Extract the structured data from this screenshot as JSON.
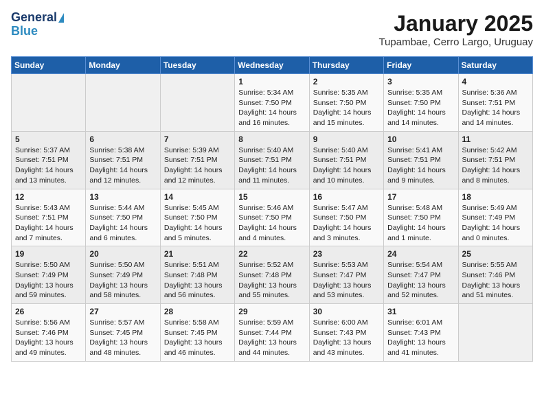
{
  "header": {
    "logo_general": "General",
    "logo_blue": "Blue",
    "title": "January 2025",
    "subtitle": "Tupambae, Cerro Largo, Uruguay"
  },
  "calendar": {
    "weekdays": [
      "Sunday",
      "Monday",
      "Tuesday",
      "Wednesday",
      "Thursday",
      "Friday",
      "Saturday"
    ],
    "weeks": [
      [
        {
          "day": "",
          "sunrise": "",
          "sunset": "",
          "daylight": ""
        },
        {
          "day": "",
          "sunrise": "",
          "sunset": "",
          "daylight": ""
        },
        {
          "day": "",
          "sunrise": "",
          "sunset": "",
          "daylight": ""
        },
        {
          "day": "1",
          "sunrise": "Sunrise: 5:34 AM",
          "sunset": "Sunset: 7:50 PM",
          "daylight": "Daylight: 14 hours and 16 minutes."
        },
        {
          "day": "2",
          "sunrise": "Sunrise: 5:35 AM",
          "sunset": "Sunset: 7:50 PM",
          "daylight": "Daylight: 14 hours and 15 minutes."
        },
        {
          "day": "3",
          "sunrise": "Sunrise: 5:35 AM",
          "sunset": "Sunset: 7:50 PM",
          "daylight": "Daylight: 14 hours and 14 minutes."
        },
        {
          "day": "4",
          "sunrise": "Sunrise: 5:36 AM",
          "sunset": "Sunset: 7:51 PM",
          "daylight": "Daylight: 14 hours and 14 minutes."
        }
      ],
      [
        {
          "day": "5",
          "sunrise": "Sunrise: 5:37 AM",
          "sunset": "Sunset: 7:51 PM",
          "daylight": "Daylight: 14 hours and 13 minutes."
        },
        {
          "day": "6",
          "sunrise": "Sunrise: 5:38 AM",
          "sunset": "Sunset: 7:51 PM",
          "daylight": "Daylight: 14 hours and 12 minutes."
        },
        {
          "day": "7",
          "sunrise": "Sunrise: 5:39 AM",
          "sunset": "Sunset: 7:51 PM",
          "daylight": "Daylight: 14 hours and 12 minutes."
        },
        {
          "day": "8",
          "sunrise": "Sunrise: 5:40 AM",
          "sunset": "Sunset: 7:51 PM",
          "daylight": "Daylight: 14 hours and 11 minutes."
        },
        {
          "day": "9",
          "sunrise": "Sunrise: 5:40 AM",
          "sunset": "Sunset: 7:51 PM",
          "daylight": "Daylight: 14 hours and 10 minutes."
        },
        {
          "day": "10",
          "sunrise": "Sunrise: 5:41 AM",
          "sunset": "Sunset: 7:51 PM",
          "daylight": "Daylight: 14 hours and 9 minutes."
        },
        {
          "day": "11",
          "sunrise": "Sunrise: 5:42 AM",
          "sunset": "Sunset: 7:51 PM",
          "daylight": "Daylight: 14 hours and 8 minutes."
        }
      ],
      [
        {
          "day": "12",
          "sunrise": "Sunrise: 5:43 AM",
          "sunset": "Sunset: 7:51 PM",
          "daylight": "Daylight: 14 hours and 7 minutes."
        },
        {
          "day": "13",
          "sunrise": "Sunrise: 5:44 AM",
          "sunset": "Sunset: 7:50 PM",
          "daylight": "Daylight: 14 hours and 6 minutes."
        },
        {
          "day": "14",
          "sunrise": "Sunrise: 5:45 AM",
          "sunset": "Sunset: 7:50 PM",
          "daylight": "Daylight: 14 hours and 5 minutes."
        },
        {
          "day": "15",
          "sunrise": "Sunrise: 5:46 AM",
          "sunset": "Sunset: 7:50 PM",
          "daylight": "Daylight: 14 hours and 4 minutes."
        },
        {
          "day": "16",
          "sunrise": "Sunrise: 5:47 AM",
          "sunset": "Sunset: 7:50 PM",
          "daylight": "Daylight: 14 hours and 3 minutes."
        },
        {
          "day": "17",
          "sunrise": "Sunrise: 5:48 AM",
          "sunset": "Sunset: 7:50 PM",
          "daylight": "Daylight: 14 hours and 1 minute."
        },
        {
          "day": "18",
          "sunrise": "Sunrise: 5:49 AM",
          "sunset": "Sunset: 7:49 PM",
          "daylight": "Daylight: 14 hours and 0 minutes."
        }
      ],
      [
        {
          "day": "19",
          "sunrise": "Sunrise: 5:50 AM",
          "sunset": "Sunset: 7:49 PM",
          "daylight": "Daylight: 13 hours and 59 minutes."
        },
        {
          "day": "20",
          "sunrise": "Sunrise: 5:50 AM",
          "sunset": "Sunset: 7:49 PM",
          "daylight": "Daylight: 13 hours and 58 minutes."
        },
        {
          "day": "21",
          "sunrise": "Sunrise: 5:51 AM",
          "sunset": "Sunset: 7:48 PM",
          "daylight": "Daylight: 13 hours and 56 minutes."
        },
        {
          "day": "22",
          "sunrise": "Sunrise: 5:52 AM",
          "sunset": "Sunset: 7:48 PM",
          "daylight": "Daylight: 13 hours and 55 minutes."
        },
        {
          "day": "23",
          "sunrise": "Sunrise: 5:53 AM",
          "sunset": "Sunset: 7:47 PM",
          "daylight": "Daylight: 13 hours and 53 minutes."
        },
        {
          "day": "24",
          "sunrise": "Sunrise: 5:54 AM",
          "sunset": "Sunset: 7:47 PM",
          "daylight": "Daylight: 13 hours and 52 minutes."
        },
        {
          "day": "25",
          "sunrise": "Sunrise: 5:55 AM",
          "sunset": "Sunset: 7:46 PM",
          "daylight": "Daylight: 13 hours and 51 minutes."
        }
      ],
      [
        {
          "day": "26",
          "sunrise": "Sunrise: 5:56 AM",
          "sunset": "Sunset: 7:46 PM",
          "daylight": "Daylight: 13 hours and 49 minutes."
        },
        {
          "day": "27",
          "sunrise": "Sunrise: 5:57 AM",
          "sunset": "Sunset: 7:45 PM",
          "daylight": "Daylight: 13 hours and 48 minutes."
        },
        {
          "day": "28",
          "sunrise": "Sunrise: 5:58 AM",
          "sunset": "Sunset: 7:45 PM",
          "daylight": "Daylight: 13 hours and 46 minutes."
        },
        {
          "day": "29",
          "sunrise": "Sunrise: 5:59 AM",
          "sunset": "Sunset: 7:44 PM",
          "daylight": "Daylight: 13 hours and 44 minutes."
        },
        {
          "day": "30",
          "sunrise": "Sunrise: 6:00 AM",
          "sunset": "Sunset: 7:43 PM",
          "daylight": "Daylight: 13 hours and 43 minutes."
        },
        {
          "day": "31",
          "sunrise": "Sunrise: 6:01 AM",
          "sunset": "Sunset: 7:43 PM",
          "daylight": "Daylight: 13 hours and 41 minutes."
        },
        {
          "day": "",
          "sunrise": "",
          "sunset": "",
          "daylight": ""
        }
      ]
    ]
  }
}
